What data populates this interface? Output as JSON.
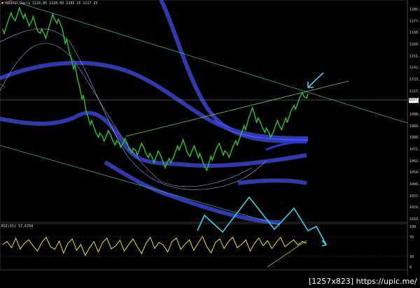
{
  "window": {
    "symbol_bar": "XAUUSD,Daily",
    "ohlc": "1116.85 1120.60 1105.15 1117.25"
  },
  "rsi": {
    "label": "RSI(15) 57.6764"
  },
  "price_axis": {
    "labels": [
      "1185.00",
      "1177.15",
      "1168.70",
      "1160.25",
      "1151.80",
      "1142.35",
      "1133.90",
      "1117.25",
      "1107.05",
      "1098.60",
      "1089.15",
      "1080.70",
      "1071.25",
      "1062.80",
      "1054.35",
      "1046.90",
      "1037.45",
      "1029.00",
      "1019.55"
    ],
    "current": "1117.25"
  },
  "rsi_axis": {
    "labels": [
      "100",
      "70",
      "30",
      "0"
    ]
  },
  "watermark": "[1257x823] https://upic.me/",
  "colors": {
    "background": "#000000",
    "price": "#2ec52e",
    "band_blue": "#2a35d6",
    "band_glow": "#7f88ff",
    "channel": "#2fb3a8",
    "trendline": "#7fd04a",
    "rsi_line": "#f2e619",
    "cyan_annotation": "#33d6f2",
    "crosshair": "#9a9a9a"
  },
  "chart_data": {
    "type": "line",
    "title": "",
    "series": [
      {
        "values": [
          1168,
          1175,
          1181,
          1178,
          1185,
          1180,
          1174,
          1178,
          1170,
          1168,
          1164,
          1172,
          1180,
          1176,
          1171,
          1160,
          1150,
          1140,
          1128,
          1116,
          1104,
          1096,
          1090,
          1086,
          1083,
          1088,
          1084,
          1080,
          1078,
          1082,
          1077,
          1074,
          1072,
          1078,
          1074,
          1070,
          1066,
          1072,
          1068,
          1062,
          1066,
          1070,
          1076,
          1081,
          1074,
          1071,
          1076,
          1070,
          1064,
          1060,
          1068,
          1074,
          1078,
          1072,
          1070,
          1076,
          1080,
          1086,
          1092,
          1100,
          1106,
          1098,
          1094,
          1090,
          1086,
          1090,
          1096,
          1092,
          1098,
          1104,
          1108,
          1114,
          1118,
          1117
        ]
      }
    ],
    "rsi_values": [
      55,
      62,
      48,
      70,
      45,
      58,
      66,
      52,
      40,
      60,
      72,
      50,
      44,
      63,
      35,
      58,
      68,
      42,
      55,
      30,
      48,
      62,
      38,
      60,
      70,
      45,
      52,
      65,
      40,
      55,
      68,
      50,
      34,
      58,
      72,
      46,
      60,
      54,
      38,
      62,
      70,
      44,
      56,
      66,
      42,
      58,
      74,
      50,
      36,
      60,
      68,
      46,
      62,
      72,
      48,
      55,
      66,
      40,
      58,
      70,
      52,
      64,
      46,
      60,
      72,
      50,
      58,
      66,
      54,
      62,
      58
    ],
    "rsi_scale": [
      0,
      100
    ]
  }
}
